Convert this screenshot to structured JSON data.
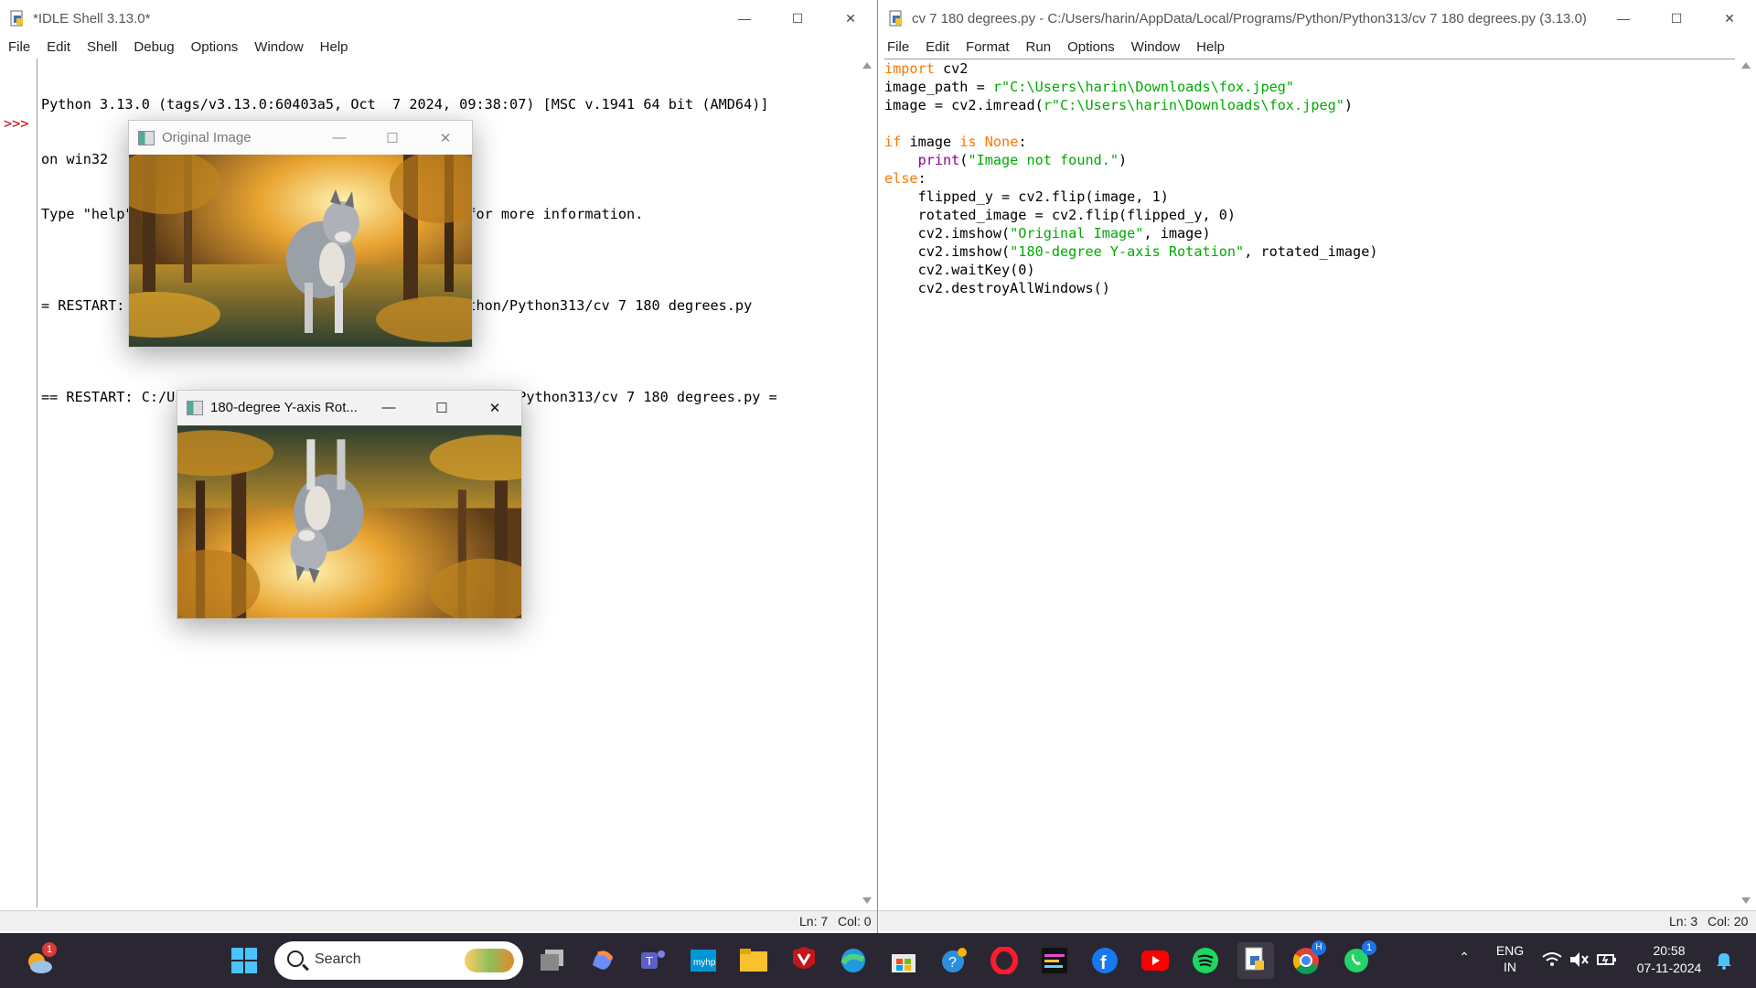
{
  "shell": {
    "title": "*IDLE Shell 3.13.0*",
    "menu": [
      "File",
      "Edit",
      "Shell",
      "Debug",
      "Options",
      "Window",
      "Help"
    ],
    "lines": [
      "Python 3.13.0 (tags/v3.13.0:60403a5, Oct  7 2024, 09:38:07) [MSC v.1941 64 bit (AMD64)]",
      "on win32",
      "Type \"help\", \"copyright\", \"credits\" or \"license()\" for more information.",
      "",
      "= RESTART: C:/Users/harin/AppData/Local/Programs/Python/Python313/cv 7 180 degrees.py",
      "",
      "== RESTART: C:/Users/harin/AppData/Local/Programs/Python/Python313/cv 7 180 degrees.py ="
    ],
    "prompt": ">>>",
    "status_ln": "Ln: 7",
    "status_col": "Col: 0"
  },
  "editor": {
    "title": "cv 7 180 degrees.py - C:/Users/harin/AppData/Local/Programs/Python/Python313/cv 7 180 degrees.py (3.13.0)",
    "menu": [
      "File",
      "Edit",
      "Format",
      "Run",
      "Options",
      "Window",
      "Help"
    ],
    "status_ln": "Ln: 3",
    "status_col": "Col: 20"
  },
  "cv_original": {
    "title": "Original Image"
  },
  "cv_rotated": {
    "title": "180-degree Y-axis Rot..."
  },
  "taskbar": {
    "search_placeholder": "Search",
    "lang": "ENG",
    "region": "IN",
    "time": "20:58",
    "date": "07-11-2024",
    "weather_badge": "1",
    "chrome_badge": "H",
    "whatsapp_badge": "1"
  },
  "colors": {
    "keyword": "#ff7700",
    "string": "#00aa00",
    "builtin": "#900090",
    "taskbar": "#2a2733"
  }
}
